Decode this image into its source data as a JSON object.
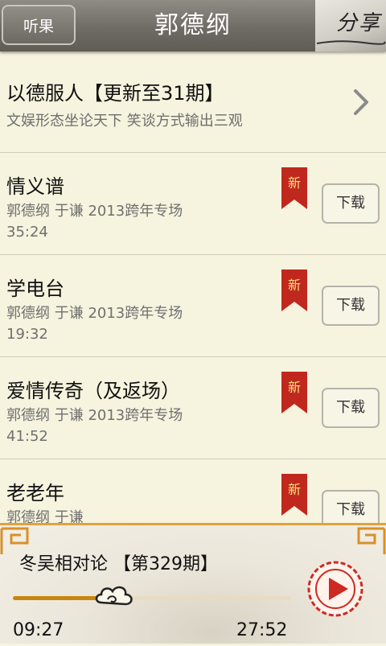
{
  "header": {
    "back_label": "听果",
    "title": "郭德纲",
    "share_label": "分享"
  },
  "series": {
    "title": "以德服人【更新至31期】",
    "subtitle": "文娱形态坐论天下 笑谈方式输出三观"
  },
  "episodes": [
    {
      "title": "情义谱",
      "subtitle": "郭德纲 于谦 2013跨年专场",
      "duration": "35:24",
      "badge": "新",
      "download_label": "下载"
    },
    {
      "title": "学电台",
      "subtitle": "郭德纲 于谦 2013跨年专场",
      "duration": "19:32",
      "badge": "新",
      "download_label": "下载"
    },
    {
      "title": "爱情传奇（及返场）",
      "subtitle": "郭德纲 于谦 2013跨年专场",
      "duration": "41:52",
      "badge": "新",
      "download_label": "下载"
    },
    {
      "title": "老老年",
      "subtitle": "郭德纲 于谦",
      "duration": "",
      "badge": "新",
      "download_label": "下载"
    }
  ],
  "player": {
    "now_playing": "冬吴相对论 【第329期】",
    "current_time": "09:27",
    "total_time": "27:52",
    "progress": 0.339
  },
  "colors": {
    "header_bg": "#6f6c65",
    "page_bg": "#f6f3de",
    "badge_red": "#c0281e",
    "accent_gold": "#e0a23a",
    "play_red": "#cc2a22"
  },
  "icons": {
    "chevron": "chevron-right-icon",
    "play": "play-icon",
    "knob": "cloud-knob-icon"
  }
}
